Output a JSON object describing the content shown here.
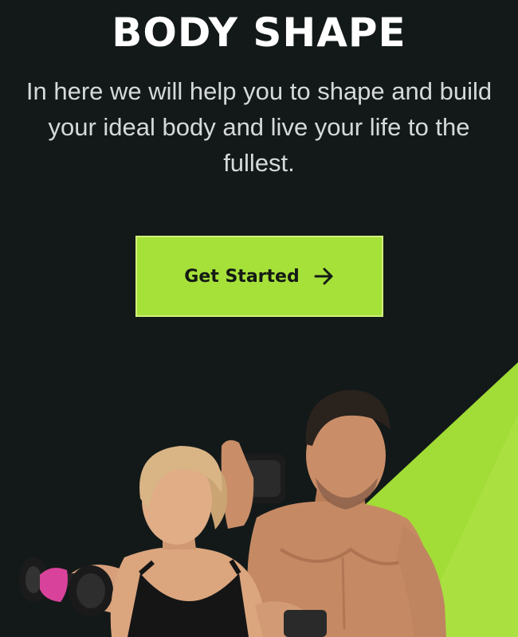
{
  "hero": {
    "title": "BODY SHAPE",
    "subtitle": "In here we will help you to shape and build your ideal body and live your life to the fullest."
  },
  "cta": {
    "label": "Get Started",
    "icon": "arrow-right-icon"
  },
  "colors": {
    "background": "#131919",
    "accent": "#a6e13a",
    "title": "#ffffff",
    "subtitle": "#d6d9d9"
  }
}
